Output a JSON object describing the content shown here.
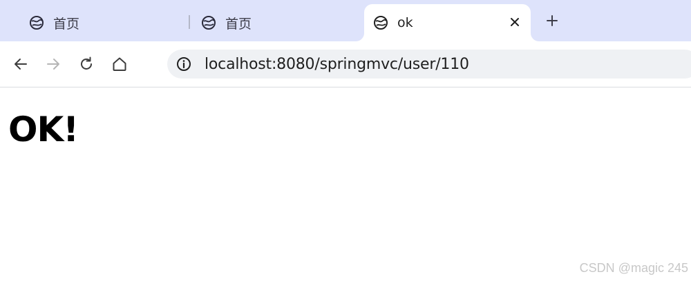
{
  "tabs": [
    {
      "title": "首页",
      "icon": "globe-icon",
      "active": false
    },
    {
      "title": "首页",
      "icon": "globe-icon",
      "active": false
    },
    {
      "title": "ok",
      "icon": "globe-icon",
      "active": true
    }
  ],
  "toolbar": {
    "back_icon": "arrow-left-icon",
    "forward_icon": "arrow-right-icon",
    "reload_icon": "reload-icon",
    "home_icon": "home-icon",
    "site_info_icon": "info-icon",
    "url": "localhost:8080/springmvc/user/110"
  },
  "page": {
    "heading": "OK!"
  },
  "watermark": "CSDN @magic 245",
  "colors": {
    "tabstrip_bg": "#dee3fb",
    "omnibox_bg": "#eff1f4",
    "active_tab_bg": "#ffffff"
  }
}
